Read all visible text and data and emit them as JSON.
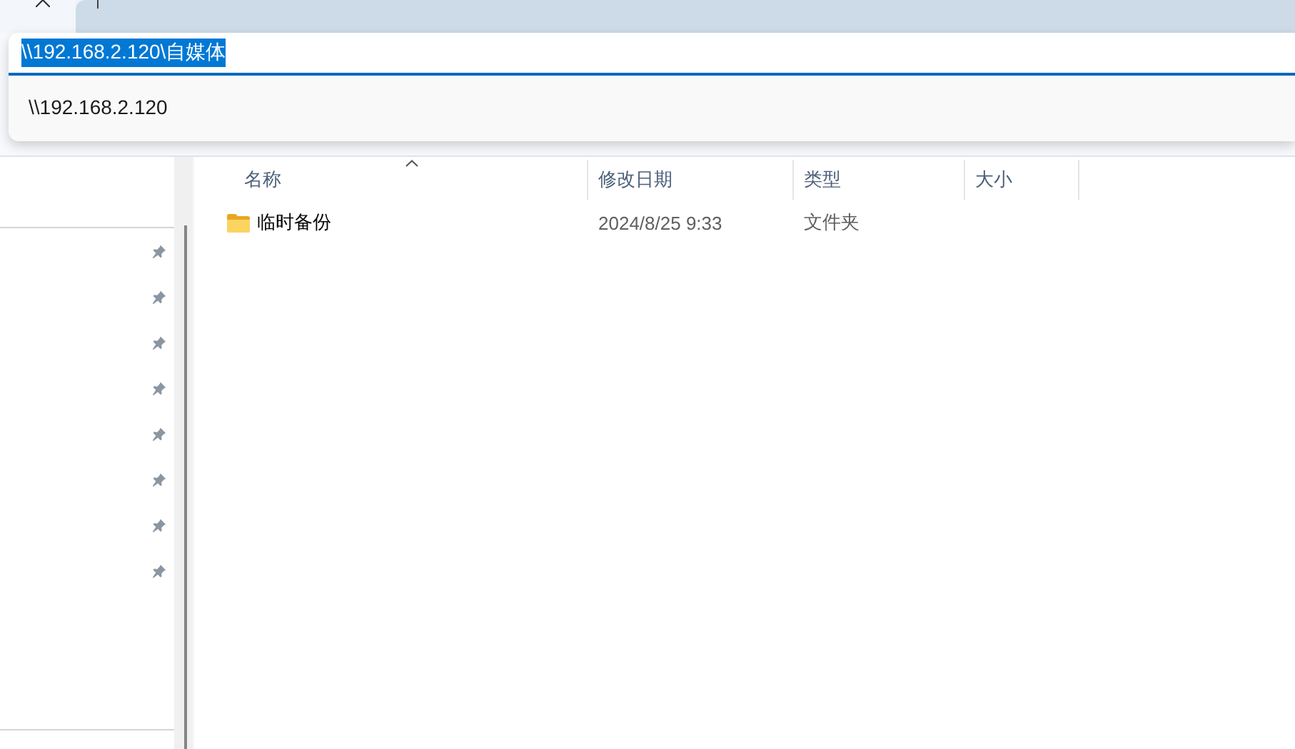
{
  "address_bar": {
    "value": "\\\\192.168.2.120\\自媒体",
    "text_selected": true,
    "suggestions": [
      {
        "label": "\\\\192.168.2.120"
      }
    ]
  },
  "sidebar": {
    "items": [
      {
        "pinned": true
      },
      {
        "pinned": true
      },
      {
        "pinned": true
      },
      {
        "pinned": true
      },
      {
        "pinned": true
      },
      {
        "pinned": true
      },
      {
        "pinned": true
      },
      {
        "pinned": true
      }
    ]
  },
  "file_list": {
    "columns": [
      {
        "label": "名称",
        "sorted": true
      },
      {
        "label": "修改日期",
        "sorted": false
      },
      {
        "label": "类型",
        "sorted": false
      },
      {
        "label": "大小",
        "sorted": false
      }
    ],
    "rows": [
      {
        "kind": "folder",
        "name": "临时备份",
        "modified": "2024/8/25 9:33",
        "type": "文件夹"
      }
    ]
  }
}
